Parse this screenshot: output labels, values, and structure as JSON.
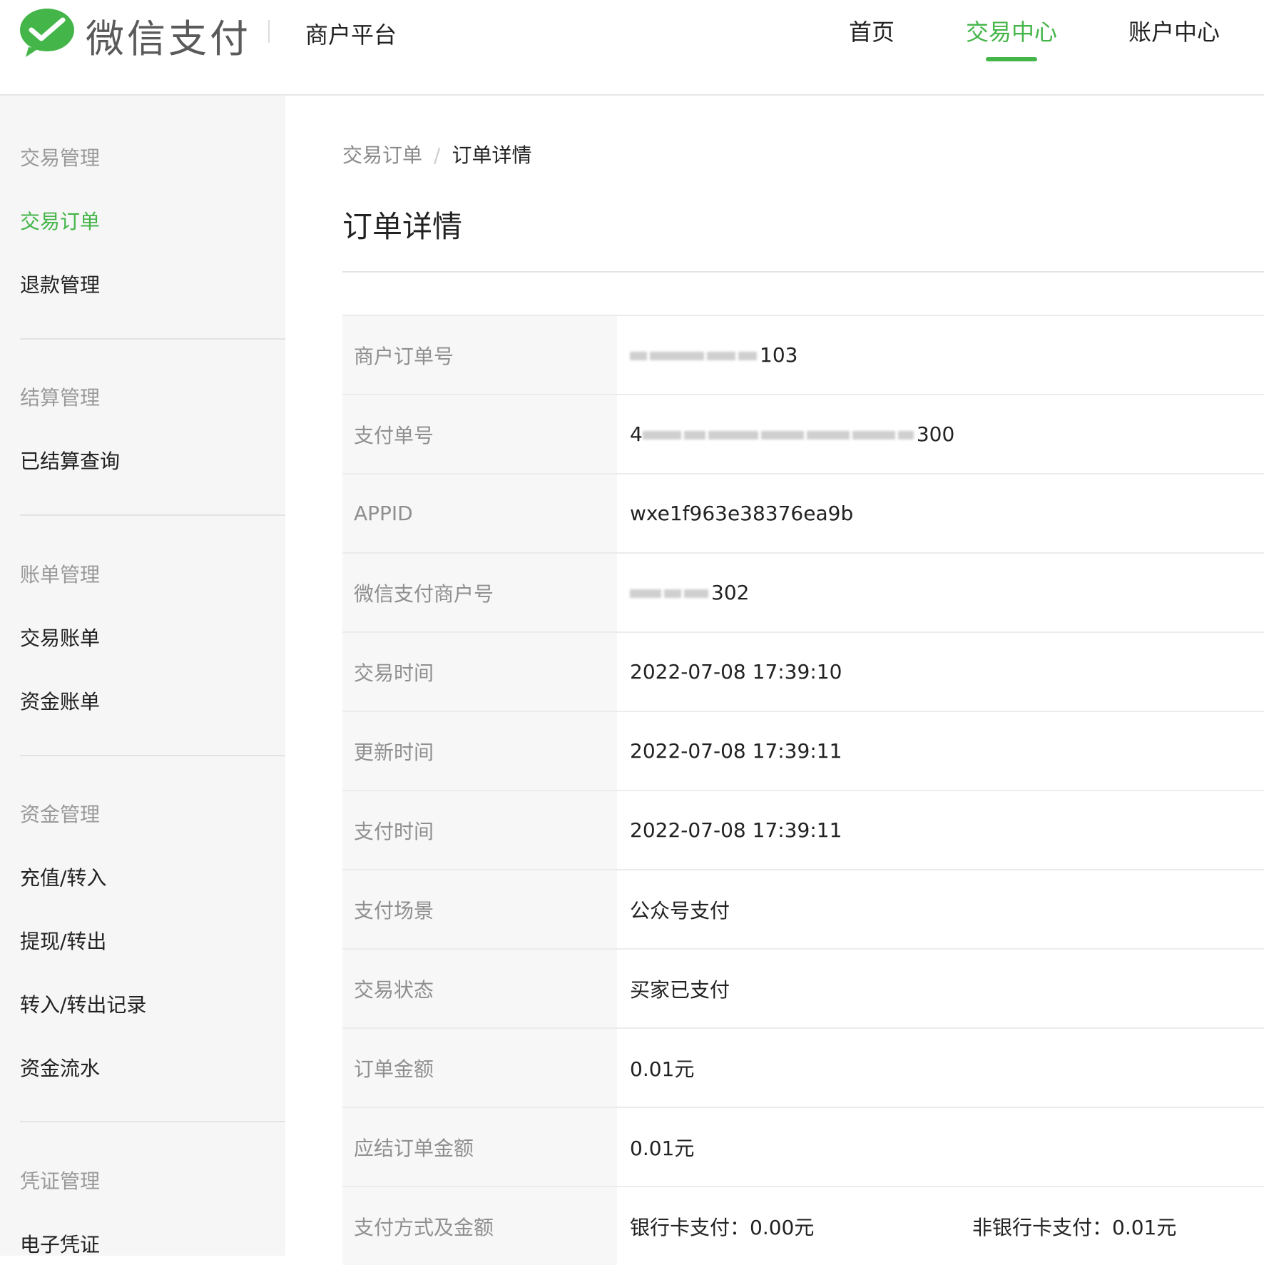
{
  "header": {
    "brand": "微信支付",
    "platform": "商户平台",
    "nav": [
      {
        "label": "首页",
        "active": false
      },
      {
        "label": "交易中心",
        "active": true
      },
      {
        "label": "账户中心",
        "active": false
      }
    ],
    "accent_color": "#44b549"
  },
  "sidebar": {
    "groups": [
      {
        "title": "交易管理",
        "items": [
          {
            "label": "交易订单",
            "active": true
          },
          {
            "label": "退款管理",
            "active": false
          }
        ]
      },
      {
        "title": "结算管理",
        "items": [
          {
            "label": "已结算查询",
            "active": false
          }
        ]
      },
      {
        "title": "账单管理",
        "items": [
          {
            "label": "交易账单",
            "active": false
          },
          {
            "label": "资金账单",
            "active": false
          }
        ]
      },
      {
        "title": "资金管理",
        "items": [
          {
            "label": "充值/转入",
            "active": false
          },
          {
            "label": "提现/转出",
            "active": false
          },
          {
            "label": "转入/转出记录",
            "active": false
          },
          {
            "label": "资金流水",
            "active": false
          }
        ]
      },
      {
        "title": "凭证管理",
        "items": [
          {
            "label": "电子凭证",
            "active": false
          }
        ]
      }
    ]
  },
  "breadcrumb": {
    "parent": "交易订单",
    "separator": "/",
    "current": "订单详情"
  },
  "page_title": "订单详情",
  "details": [
    {
      "label": "商户订单号",
      "value": "2022070...1103",
      "masked_suffix": "103"
    },
    {
      "label": "支付单号",
      "value": "42000...300",
      "masked_prefix": "4",
      "masked_suffix": "300"
    },
    {
      "label": "APPID",
      "value": "wxe1f963e38376ea9b"
    },
    {
      "label": "微信支付商户号",
      "value": "1...302",
      "masked_suffix": "302"
    },
    {
      "label": "交易时间",
      "value": "2022-07-08 17:39:10"
    },
    {
      "label": "更新时间",
      "value": "2022-07-08 17:39:11"
    },
    {
      "label": "支付时间",
      "value": "2022-07-08 17:39:11"
    },
    {
      "label": "支付场景",
      "value": "公众号支付"
    },
    {
      "label": "交易状态",
      "value": "买家已支付"
    },
    {
      "label": "订单金额",
      "value": "0.01元"
    },
    {
      "label": "应结订单金额",
      "value": "0.01元"
    },
    {
      "label": "支付方式及金额",
      "bank": "银行卡支付：0.00元",
      "non_bank": "非银行卡支付：0.01元"
    }
  ]
}
